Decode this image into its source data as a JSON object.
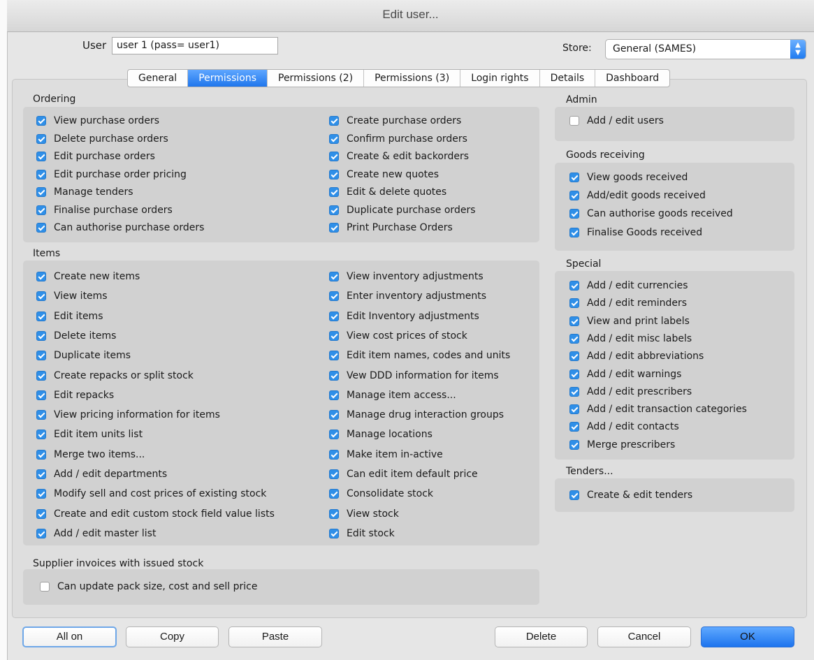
{
  "window": {
    "title": "Edit user..."
  },
  "user": {
    "label": "User",
    "value": "user 1 (pass= user1)"
  },
  "store": {
    "label": "Store:",
    "value": "General (SAMES)"
  },
  "tabs": [
    {
      "label": "General",
      "active": false
    },
    {
      "label": "Permissions",
      "active": true
    },
    {
      "label": "Permissions (2)",
      "active": false
    },
    {
      "label": "Permissions (3)",
      "active": false
    },
    {
      "label": "Login rights",
      "active": false
    },
    {
      "label": "Details",
      "active": false
    },
    {
      "label": "Dashboard",
      "active": false
    }
  ],
  "ordering": {
    "title": "Ordering",
    "col1": [
      {
        "label": "View purchase orders",
        "checked": true
      },
      {
        "label": "Delete purchase orders",
        "checked": true
      },
      {
        "label": "Edit purchase orders",
        "checked": true
      },
      {
        "label": "Edit purchase order pricing",
        "checked": true
      },
      {
        "label": "Manage tenders",
        "checked": true
      },
      {
        "label": "Finalise purchase orders",
        "checked": true
      },
      {
        "label": "Can authorise purchase orders",
        "checked": true
      }
    ],
    "col2": [
      {
        "label": "Create purchase orders",
        "checked": true
      },
      {
        "label": "Confirm purchase orders",
        "checked": true
      },
      {
        "label": "Create & edit backorders",
        "checked": true
      },
      {
        "label": "Create new quotes",
        "checked": true
      },
      {
        "label": "Edit & delete quotes",
        "checked": true
      },
      {
        "label": "Duplicate purchase orders",
        "checked": true
      },
      {
        "label": "Print Purchase Orders",
        "checked": true
      }
    ]
  },
  "items": {
    "title": "Items",
    "col1": [
      {
        "label": "Create new items",
        "checked": true
      },
      {
        "label": "View items",
        "checked": true
      },
      {
        "label": "Edit items",
        "checked": true
      },
      {
        "label": "Delete items",
        "checked": true
      },
      {
        "label": "Duplicate items",
        "checked": true
      },
      {
        "label": "Create repacks or split stock",
        "checked": true
      },
      {
        "label": "Edit repacks",
        "checked": true
      },
      {
        "label": "View pricing information for items",
        "checked": true
      },
      {
        "label": "Edit item units list",
        "checked": true
      },
      {
        "label": "Merge two items...",
        "checked": true
      },
      {
        "label": "Add / edit departments",
        "checked": true
      },
      {
        "label": "Modify sell and cost prices of existing stock",
        "checked": true
      },
      {
        "label": "Create and edit custom stock field value lists",
        "checked": true
      },
      {
        "label": "Add / edit master list",
        "checked": true
      }
    ],
    "col2": [
      {
        "label": "View inventory adjustments",
        "checked": true
      },
      {
        "label": "Enter inventory adjustments",
        "checked": true
      },
      {
        "label": "Edit Inventory adjustments",
        "checked": true
      },
      {
        "label": "View cost prices of stock",
        "checked": true
      },
      {
        "label": "Edit item names, codes and units",
        "checked": true
      },
      {
        "label": "Vew DDD information for items",
        "checked": true
      },
      {
        "label": "Manage item access...",
        "checked": true
      },
      {
        "label": "Manage drug interaction groups",
        "checked": true
      },
      {
        "label": "Manage locations",
        "checked": true
      },
      {
        "label": "Make item in-active",
        "checked": true
      },
      {
        "label": "Can edit item default price",
        "checked": true
      },
      {
        "label": "Consolidate stock",
        "checked": true
      },
      {
        "label": "View stock",
        "checked": true
      },
      {
        "label": "Edit stock",
        "checked": true
      }
    ]
  },
  "supplier": {
    "title": "Supplier invoices with issued stock",
    "items": [
      {
        "label": "Can update pack size, cost and sell price",
        "checked": false
      }
    ]
  },
  "admin": {
    "title": "Admin",
    "items": [
      {
        "label": "Add / edit users",
        "checked": false
      }
    ]
  },
  "goods": {
    "title": "Goods receiving",
    "items": [
      {
        "label": "View goods received",
        "checked": true
      },
      {
        "label": "Add/edit goods received",
        "checked": true
      },
      {
        "label": "Can authorise goods received",
        "checked": true
      },
      {
        "label": "Finalise Goods received",
        "checked": true
      }
    ]
  },
  "special": {
    "title": "Special",
    "items": [
      {
        "label": "Add / edit currencies",
        "checked": true
      },
      {
        "label": "Add / edit reminders",
        "checked": true
      },
      {
        "label": "View and print labels",
        "checked": true
      },
      {
        "label": "Add / edit misc labels",
        "checked": true
      },
      {
        "label": "Add / edit abbreviations",
        "checked": true
      },
      {
        "label": "Add / edit warnings",
        "checked": true
      },
      {
        "label": "Add / edit prescribers",
        "checked": true
      },
      {
        "label": "Add / edit transaction categories",
        "checked": true
      },
      {
        "label": "Add / edit contacts",
        "checked": true
      },
      {
        "label": "Merge prescribers",
        "checked": true
      }
    ]
  },
  "tenders": {
    "title": "Tenders...",
    "items": [
      {
        "label": "Create & edit tenders",
        "checked": true
      }
    ]
  },
  "buttons": {
    "all_on": "All on",
    "copy": "Copy",
    "paste": "Paste",
    "delete": "Delete",
    "cancel": "Cancel",
    "ok": "OK"
  }
}
